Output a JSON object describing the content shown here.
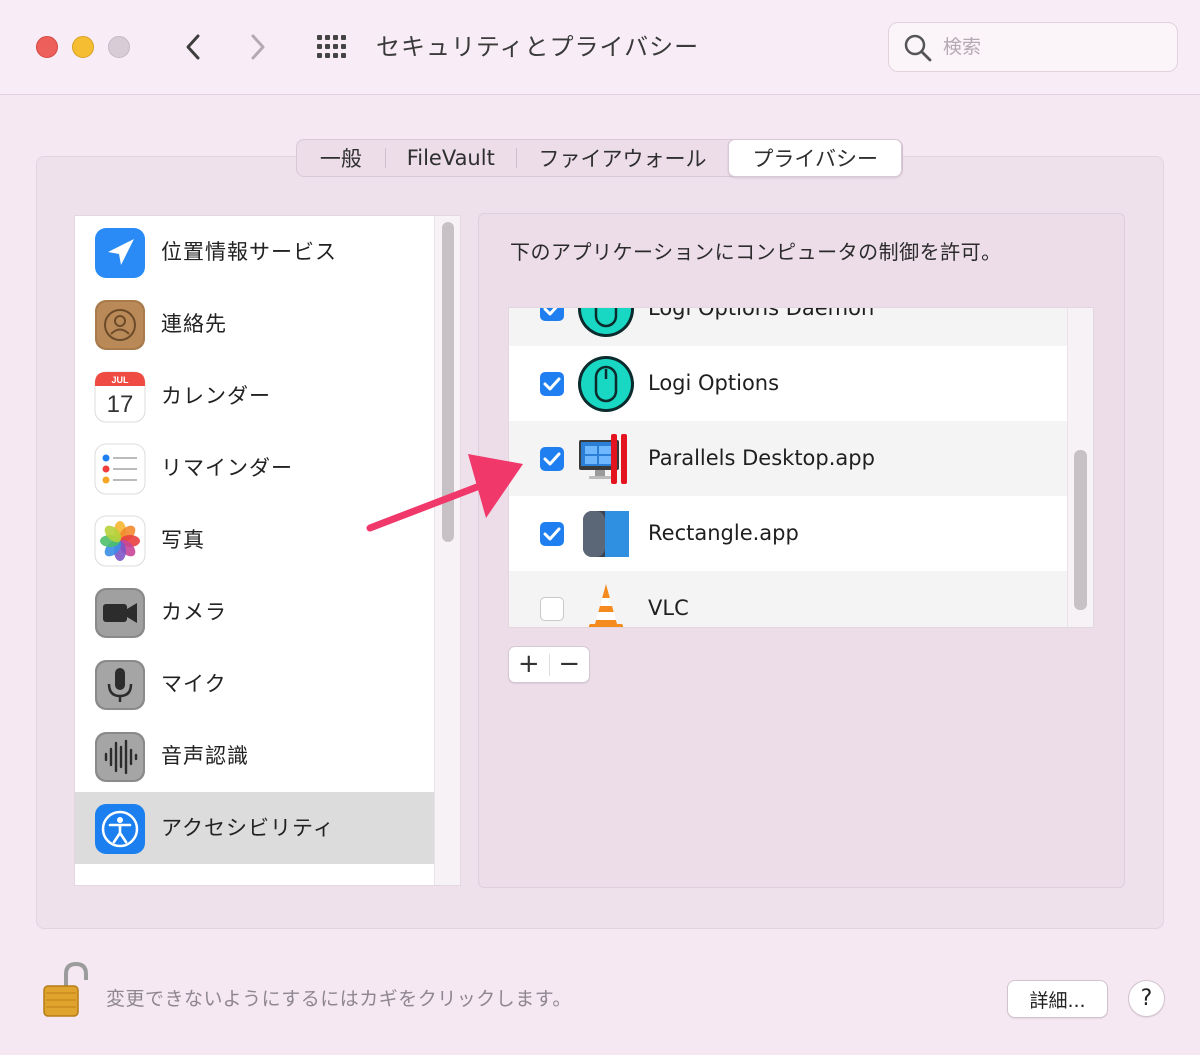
{
  "window": {
    "title": "セキュリティとプライバシー",
    "search_placeholder": "検索"
  },
  "tabs": [
    {
      "label": "一般"
    },
    {
      "label": "FileVault"
    },
    {
      "label": "ファイアウォール"
    },
    {
      "label": "プライバシー",
      "selected": true
    }
  ],
  "sidebar": {
    "items": [
      {
        "label": "位置情報サービス",
        "icon": "location-icon"
      },
      {
        "label": "連絡先",
        "icon": "contacts-icon"
      },
      {
        "label": "カレンダー",
        "icon": "calendar-icon",
        "calendar_month": "JUL",
        "calendar_day": "17"
      },
      {
        "label": "リマインダー",
        "icon": "reminders-icon"
      },
      {
        "label": "写真",
        "icon": "photos-icon"
      },
      {
        "label": "カメラ",
        "icon": "camera-icon"
      },
      {
        "label": "マイク",
        "icon": "microphone-icon"
      },
      {
        "label": "音声認識",
        "icon": "speech-recognition-icon"
      },
      {
        "label": "アクセシビリティ",
        "icon": "accessibility-icon",
        "selected": true
      }
    ]
  },
  "content": {
    "description": "下のアプリケーションにコンピュータの制御を許可。",
    "apps": [
      {
        "label": "Logi Options Daemon",
        "checked": true,
        "icon": "logi-options-icon"
      },
      {
        "label": "Logi Options",
        "checked": true,
        "icon": "logi-options-icon"
      },
      {
        "label": "Parallels Desktop.app",
        "checked": true,
        "icon": "parallels-desktop-icon"
      },
      {
        "label": "Rectangle.app",
        "checked": true,
        "icon": "rectangle-icon"
      },
      {
        "label": "VLC",
        "checked": false,
        "icon": "vlc-icon"
      }
    ],
    "add_label": "+",
    "remove_label": "−"
  },
  "footer": {
    "lock_text": "変更できないようにするにはカギをクリックします。",
    "detail_label": "詳細...",
    "help_label": "?"
  },
  "colors": {
    "accent": "#1f7ff0",
    "annotation_arrow": "#f0386b",
    "window_bg": "#f5e8f3"
  }
}
